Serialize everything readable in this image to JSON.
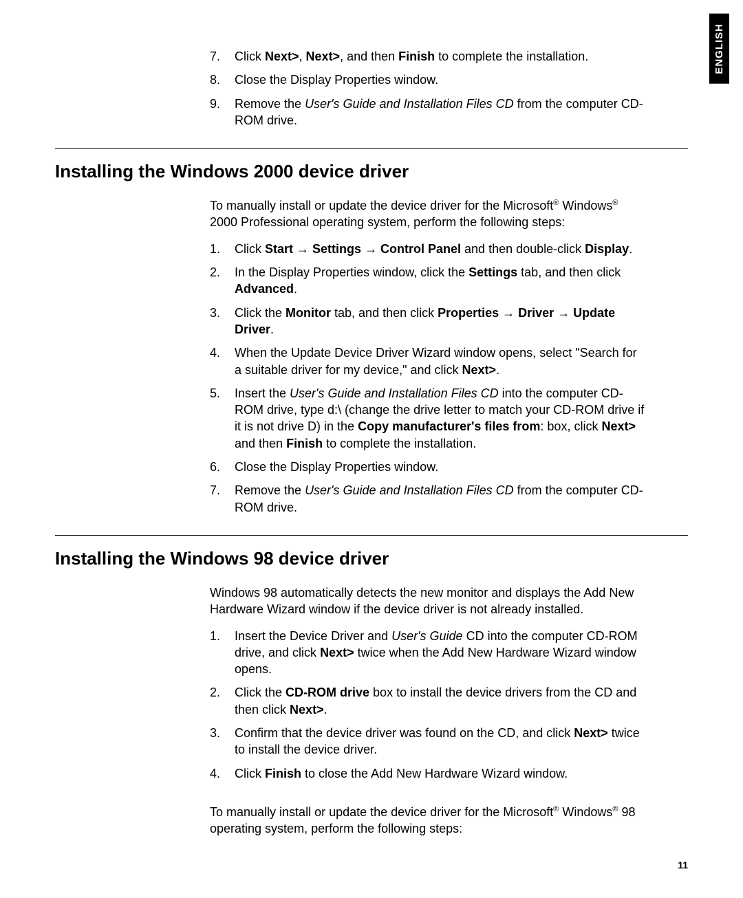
{
  "language_tab": "ENGLISH",
  "page_number": "11",
  "top_list_start": 7,
  "top_list": [
    [
      {
        "t": "Click "
      },
      {
        "t": "Next>",
        "b": true
      },
      {
        "t": ", "
      },
      {
        "t": "Next>",
        "b": true
      },
      {
        "t": ", and then "
      },
      {
        "t": "Finish",
        "b": true
      },
      {
        "t": " to complete the installation."
      }
    ],
    [
      {
        "t": "Close the Display Properties window."
      }
    ],
    [
      {
        "t": "Remove the "
      },
      {
        "t": "User's Guide and Installation Files CD",
        "i": true
      },
      {
        "t": " from the computer CD-ROM drive."
      }
    ]
  ],
  "section1_title": "Installing the Windows 2000 device driver",
  "section1_intro": [
    {
      "t": "To manually install or update the device driver for the Microsoft"
    },
    {
      "t": "®",
      "sup": true
    },
    {
      "t": " Windows"
    },
    {
      "t": "®",
      "sup": true
    },
    {
      "t": " 2000 Professional operating system, perform the following steps:"
    }
  ],
  "section1_list": [
    [
      {
        "t": "Click "
      },
      {
        "t": "Start → Settings → Control Panel",
        "b": true
      },
      {
        "t": " and then double-click "
      },
      {
        "t": "Display",
        "b": true
      },
      {
        "t": "."
      }
    ],
    [
      {
        "t": "In the Display Properties window, click the "
      },
      {
        "t": "Settings",
        "b": true
      },
      {
        "t": " tab, and then click "
      },
      {
        "t": "Advanced",
        "b": true
      },
      {
        "t": "."
      }
    ],
    [
      {
        "t": "Click the "
      },
      {
        "t": "Monitor",
        "b": true
      },
      {
        "t": " tab, and then click "
      },
      {
        "t": "Properties → Driver → Update Driver",
        "b": true
      },
      {
        "t": "."
      }
    ],
    [
      {
        "t": "When the Update Device Driver Wizard window opens, select \"Search for a suitable driver for my device,\" and click "
      },
      {
        "t": "Next>",
        "b": true
      },
      {
        "t": "."
      }
    ],
    [
      {
        "t": "Insert the "
      },
      {
        "t": "User's Guide and Installation Files CD",
        "i": true
      },
      {
        "t": " into the computer CD-ROM drive, type d:\\ (change the drive letter to match your CD-ROM drive if it is not drive D) in the "
      },
      {
        "t": "Copy manufacturer's files from",
        "b": true
      },
      {
        "t": ": box, click "
      },
      {
        "t": "Next>",
        "b": true
      },
      {
        "t": " and then "
      },
      {
        "t": "Finish",
        "b": true
      },
      {
        "t": " to complete the installation."
      }
    ],
    [
      {
        "t": "Close the Display Properties window."
      }
    ],
    [
      {
        "t": "Remove the "
      },
      {
        "t": "User's Guide and Installation Files CD",
        "i": true
      },
      {
        "t": " from the computer CD-ROM drive."
      }
    ]
  ],
  "section2_title": "Installing the Windows 98 device driver",
  "section2_intro": [
    {
      "t": "Windows 98 automatically detects the new monitor and displays the Add New Hardware Wizard window if the device driver is not already installed."
    }
  ],
  "section2_list": [
    [
      {
        "t": "Insert the Device Driver and "
      },
      {
        "t": "User's Guide",
        "i": true
      },
      {
        "t": " CD into the computer CD-ROM drive, and click "
      },
      {
        "t": "Next>",
        "b": true
      },
      {
        "t": " twice when the Add New Hardware Wizard window opens."
      }
    ],
    [
      {
        "t": "Click the "
      },
      {
        "t": "CD-ROM drive",
        "b": true
      },
      {
        "t": " box to install the device drivers from the CD and then click "
      },
      {
        "t": "Next>",
        "b": true
      },
      {
        "t": "."
      }
    ],
    [
      {
        "t": "Confirm that the device driver was found on the CD, and click "
      },
      {
        "t": "Next>",
        "b": true
      },
      {
        "t": " twice to install the device driver."
      }
    ],
    [
      {
        "t": "Click "
      },
      {
        "t": "Finish",
        "b": true
      },
      {
        "t": " to close the Add New Hardware Wizard window."
      }
    ]
  ],
  "section2_outro": [
    {
      "t": "To manually install or update the device driver for the Microsoft"
    },
    {
      "t": "®",
      "sup": true
    },
    {
      "t": " Windows"
    },
    {
      "t": "®",
      "sup": true
    },
    {
      "t": " 98 operating system, perform the following steps:"
    }
  ]
}
